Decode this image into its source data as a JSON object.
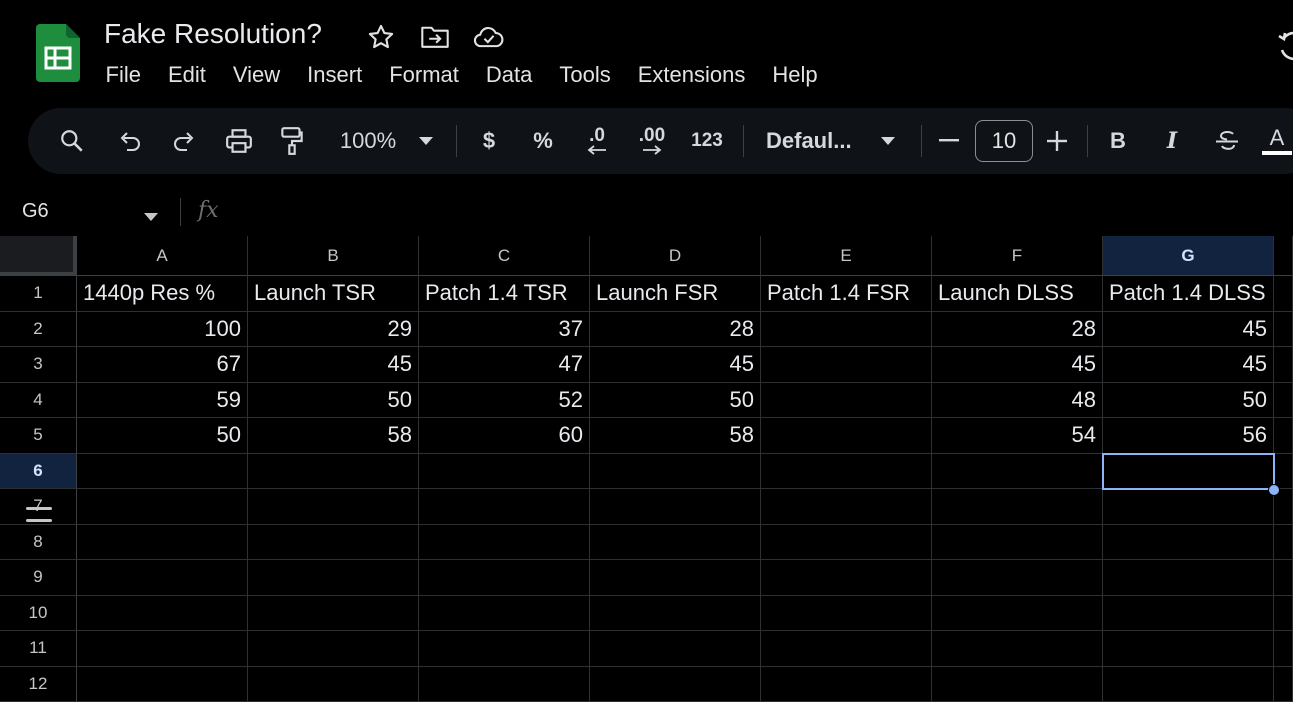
{
  "document": {
    "title": "Fake Resolution?"
  },
  "menu": [
    "File",
    "Edit",
    "View",
    "Insert",
    "Format",
    "Data",
    "Tools",
    "Extensions",
    "Help"
  ],
  "toolbar": {
    "zoom": "100%",
    "currency": "$",
    "percent": "%",
    "decrease_decimal": ".0",
    "increase_decimal": ".00",
    "number_format": "123",
    "font": "Defaul...",
    "font_size": "10",
    "bold": "B",
    "italic": "I",
    "text_color": "A"
  },
  "formula_bar": {
    "cell_ref": "G6",
    "fx": "fx",
    "value": ""
  },
  "sheet": {
    "columns": [
      "A",
      "B",
      "C",
      "D",
      "E",
      "F",
      "G"
    ],
    "rows": [
      "1",
      "2",
      "3",
      "4",
      "5",
      "6",
      "7",
      "8",
      "9",
      "10",
      "11",
      "12"
    ],
    "selected_cell": "G6",
    "selected_column": "G",
    "selected_row": "6",
    "cells": [
      [
        "1440p Res %",
        "Launch TSR",
        "Patch 1.4 TSR",
        "Launch FSR",
        "Patch 1.4 FSR",
        "Launch DLSS",
        "Patch 1.4 DLSS"
      ],
      [
        "100",
        "29",
        "37",
        "28",
        "",
        "28",
        "45"
      ],
      [
        "67",
        "45",
        "47",
        "45",
        "",
        "45",
        "45"
      ],
      [
        "59",
        "50",
        "52",
        "50",
        "",
        "48",
        "50"
      ],
      [
        "50",
        "58",
        "60",
        "58",
        "",
        "54",
        "56"
      ]
    ]
  },
  "colors": {
    "accent": "#8ab4f8",
    "selected_header_bg": "#12233f",
    "toolbar_bg": "#0f1217",
    "app_logo_green": "#1e8e3e"
  }
}
